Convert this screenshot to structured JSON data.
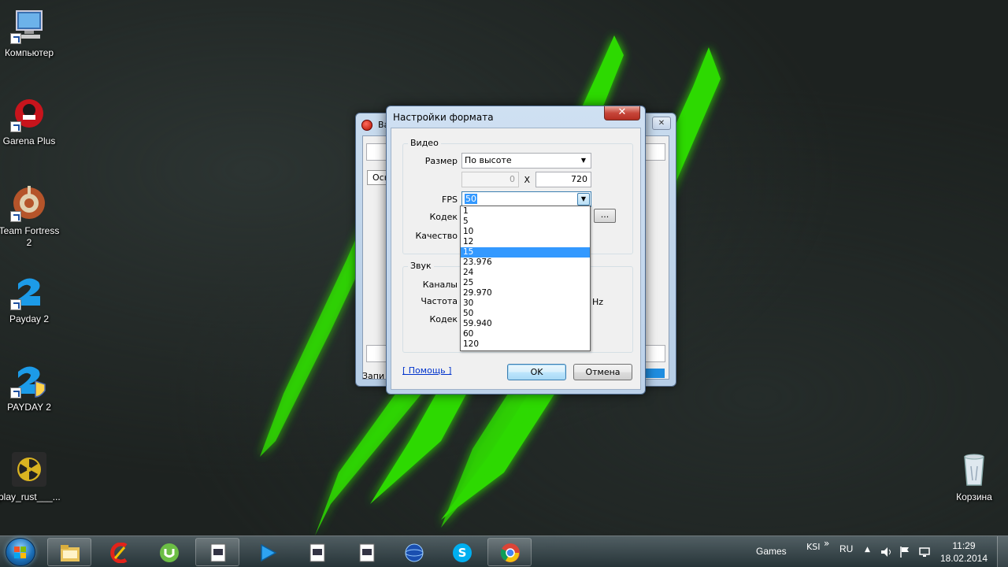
{
  "desktop": {
    "icons": [
      {
        "label": "Компьютер",
        "icon": "computer-icon"
      },
      {
        "label": "Garena Plus",
        "icon": "garena-icon"
      },
      {
        "label": "Team Fortress 2",
        "icon": "tf2-icon"
      },
      {
        "label": "Payday 2",
        "icon": "payday-icon"
      },
      {
        "label": "PAYDAY 2",
        "icon": "payday-icon"
      },
      {
        "label": "play_rust___...",
        "icon": "radiation-icon"
      },
      {
        "label": "Корзина",
        "icon": "recycle-bin-icon"
      }
    ]
  },
  "background_window": {
    "title": "Ва",
    "tab": "Осн",
    "status": "Запи",
    "close_symbol": "✕"
  },
  "dialog": {
    "title": "Настройки формата",
    "close_symbol": "✕",
    "video": {
      "legend": "Видео",
      "size_label": "Размер",
      "size_value": "По высоте",
      "width_value": "0",
      "x_sep": "X",
      "height_value": "720",
      "fps_label": "FPS",
      "fps_value": "50",
      "codec_label": "Кодек",
      "quality_label": "Качество",
      "ellipsis": "..."
    },
    "audio": {
      "legend": "Звук",
      "channels_label": "Каналы",
      "rate_label": "Частота",
      "codec_label": "Кодек",
      "hz": "Hz"
    },
    "help_link": "[ Помощь ]",
    "ok_label": "OK",
    "cancel_label": "Отмена"
  },
  "fps_dropdown": {
    "options": [
      "1",
      "5",
      "10",
      "12",
      "15",
      "23.976",
      "24",
      "25",
      "29.970",
      "30",
      "50",
      "59.940",
      "60",
      "120"
    ],
    "highlighted": "15"
  },
  "taskbar": {
    "apps": [
      "explorer-icon",
      "ccleaner-icon",
      "utorrent-icon",
      "media-file-icon",
      "media-player-icon",
      "media-file-icon",
      "media-file-icon",
      "globe-icon",
      "skype-icon",
      "chrome-icon"
    ],
    "games_label": "Games",
    "ksi_label": "KSI",
    "chevron": "»",
    "lang": "RU",
    "time": "11:29",
    "date": "18.02.2014"
  },
  "colors": {
    "claw_green": "#2fe300",
    "selection_blue": "#3399ff"
  }
}
